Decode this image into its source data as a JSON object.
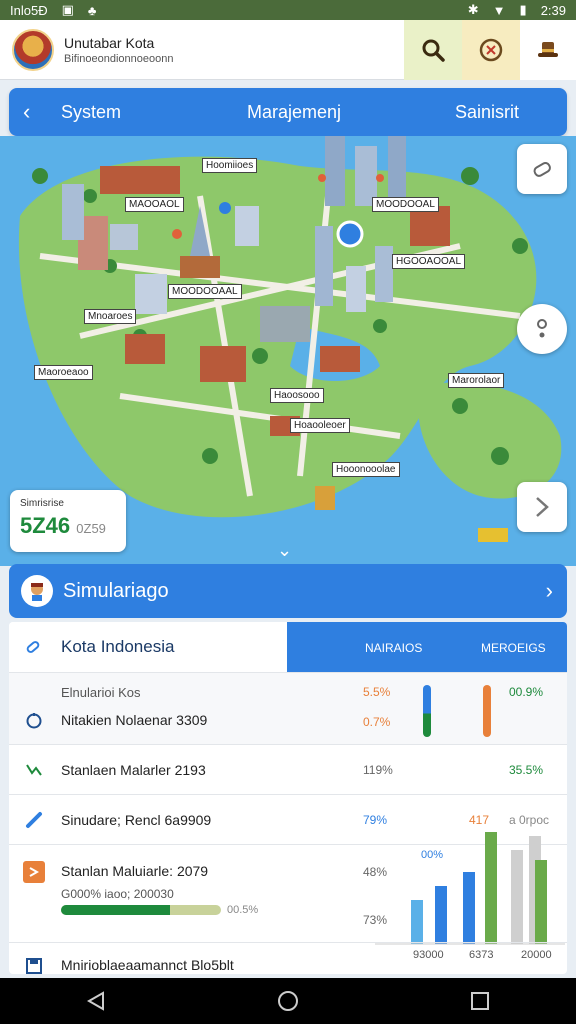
{
  "statusbar": {
    "carrier": "Inlo5Ð",
    "time": "2:39"
  },
  "header": {
    "title": "Unutabar Kota",
    "subtitle": "Bifinoeondionnoeoonn"
  },
  "nav": {
    "left": "System",
    "center": "Marajemenj",
    "right": "Sainisrit"
  },
  "map": {
    "labels": [
      "Hoomiioes",
      "MAOOAOL",
      "MOODOOAL",
      "MOODOOAAL",
      "HGOOAOOAL",
      "Mnoaroes",
      "Maoroeaoo",
      "Marorolaor",
      "Haoosooo",
      "Hoaooleoer",
      "Hooonooolae"
    ],
    "stat_label": "Simrisrise",
    "stat_value": "5Z46",
    "stat_extra": "0Z59"
  },
  "sim": {
    "title": "Simulariago"
  },
  "panel": {
    "tab_label": "Kota Indonesia",
    "col1": "NAIRAIOS",
    "col2": "MEROEIGS",
    "rows": [
      {
        "pre": "Elnularioi Kos",
        "name": "Nitakien Nolaenar 3309",
        "v1a": "5.5%",
        "v1b": "0.7%",
        "v2": "00.9%"
      },
      {
        "name": "Stanlaen Malarler 2193",
        "v1": "119%",
        "v2": "35.5%"
      },
      {
        "name": "Sinudare; Rencl 6a9909",
        "v1": "79%",
        "v2": "a 0rpoc",
        "v1b": "417"
      },
      {
        "name": "Stanlan Maluiarle: 2079",
        "sub": "G000% iaoo; 200030",
        "v1": "48%",
        "v1b": "73%",
        "v2": "00.5%",
        "bar_label": "00%"
      },
      {
        "name": "Mnirioblaeaamannct Blo5blt"
      }
    ],
    "progress": 0.68,
    "chart": {
      "xlabels": [
        "93000",
        "6373",
        "20000"
      ],
      "top_label": "00%"
    }
  },
  "colors": {
    "accent": "#2f7fe0",
    "green": "#1e8a3c",
    "orange": "#e8803a"
  }
}
